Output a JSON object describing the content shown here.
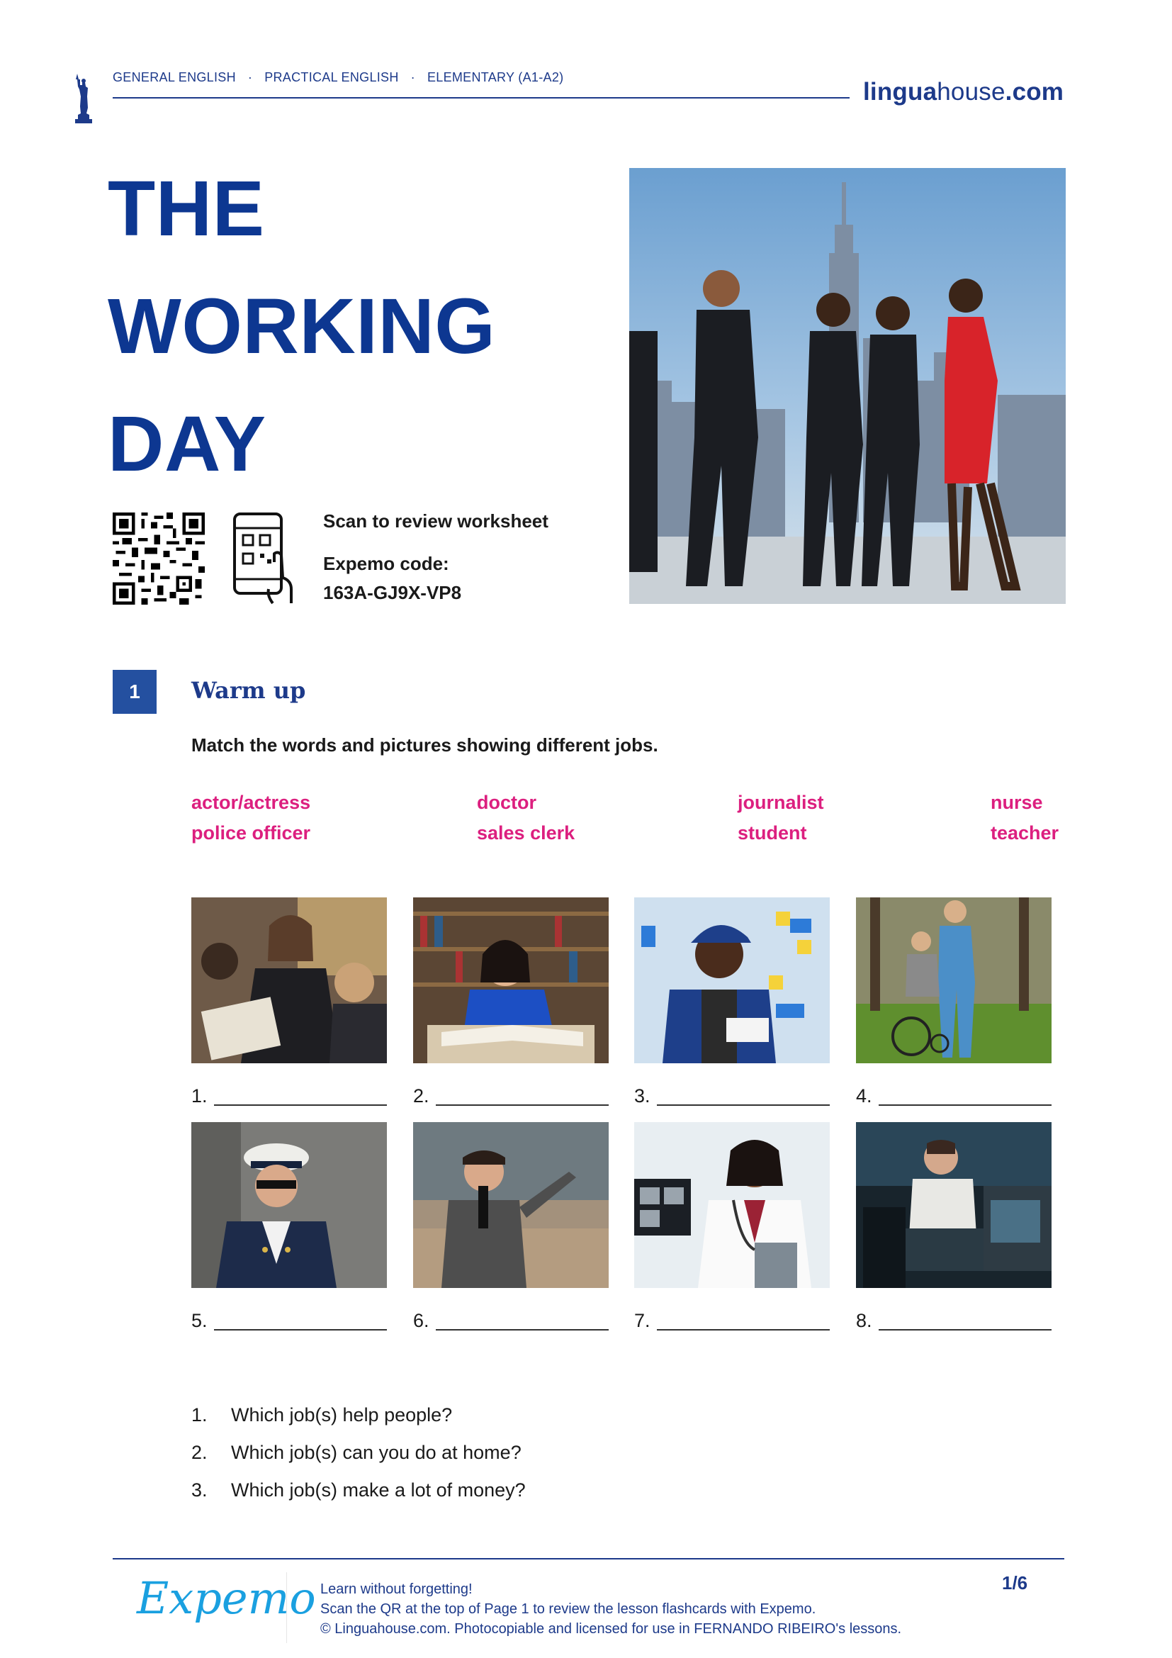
{
  "header": {
    "crumbs": [
      "GENERAL ENGLISH",
      "PRACTICAL ENGLISH",
      "ELEMENTARY (A1-A2)"
    ],
    "separator": "·",
    "brand": {
      "start": "lingua",
      "mid": "house",
      "end": ".com"
    }
  },
  "title": {
    "lines": [
      "THE",
      "WORKING",
      "DAY"
    ]
  },
  "scan": {
    "label": "Scan to review worksheet",
    "code_label": "Expemo code:",
    "code": "163A-GJ9X-VP8"
  },
  "section1": {
    "number": "1",
    "title": "Warm up",
    "instruction": "Match the words and pictures showing different jobs.",
    "words": [
      [
        "actor/actress",
        "doctor",
        "journalist",
        "nurse"
      ],
      [
        "police officer",
        "sales clerk",
        "student",
        "teacher"
      ]
    ],
    "photos": [
      {
        "num": "1.",
        "icon": "teacher-reading-photo"
      },
      {
        "num": "2.",
        "icon": "student-library-photo"
      },
      {
        "num": "3.",
        "icon": "sales-clerk-photo"
      },
      {
        "num": "4.",
        "icon": "nurse-wheelchair-photo"
      },
      {
        "num": "5.",
        "icon": "police-officer-photo"
      },
      {
        "num": "6.",
        "icon": "journalist-microphone-photo"
      },
      {
        "num": "7.",
        "icon": "doctor-stethoscope-photo"
      },
      {
        "num": "8.",
        "icon": "actress-stage-photo"
      }
    ],
    "questions": [
      {
        "num": "1.",
        "text": "Which job(s) help people?"
      },
      {
        "num": "2.",
        "text": "Which job(s) can you do at home?"
      },
      {
        "num": "3.",
        "text": "Which job(s) make a lot of money?"
      }
    ]
  },
  "footer": {
    "logo": "Expemo",
    "lines": [
      "Learn without forgetting!",
      "Scan the QR at the top of Page 1 to review the lesson flashcards with Expemo.",
      "© Linguahouse.com. Photocopiable and licensed for use in FERNANDO RIBEIRO's lessons."
    ],
    "page": "1/6"
  },
  "colors": {
    "navy": "#1d3a8a",
    "title": "#0d3791",
    "magenta": "#dc1f7f",
    "badge": "#2450a0",
    "expemo": "#1aa0e0"
  }
}
